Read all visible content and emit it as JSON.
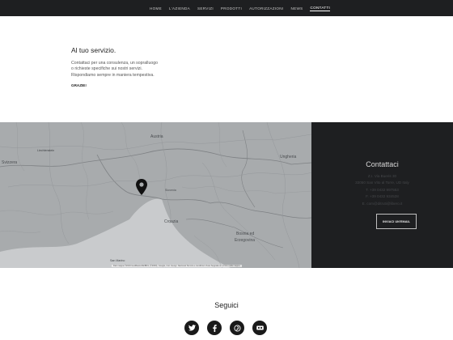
{
  "nav": {
    "items": [
      {
        "label": "HOME"
      },
      {
        "label": "L'AZIENDA"
      },
      {
        "label": "SERVIZI"
      },
      {
        "label": "PRODOTTI"
      },
      {
        "label": "AUTORIZZAZIONI"
      },
      {
        "label": "NEWS"
      },
      {
        "label": "CONTATTI",
        "active": true
      }
    ]
  },
  "intro": {
    "title": "Al tuo servizio.",
    "lines": [
      "Contattaci per una consulenza, un sopralluogo",
      "o richieste specifiche sui nostri servizi.",
      "Rispondiamo sempre in maniera tempestiva."
    ],
    "thanks": "GRAZIE!"
  },
  "map": {
    "labels": {
      "austria": "Austria",
      "ungheria": "Ungheria",
      "svizzera": "Svizzera",
      "slovenia": "Slovenia",
      "croazia": "Croazia",
      "bosnia_1": "Bosnia ed",
      "bosnia_2": "Erzegovina",
      "san_marino": "San Marino",
      "city_1": "Liechtenstein"
    },
    "attribution": "Dati mappa ©2019 GeoBasis-DE/BKG (©2009), Google, Inst. Geogr. Nacional   Termini e condizioni d'uso   Segnala un errore nella mappa"
  },
  "contact": {
    "title": "Contattaci",
    "lines": [
      "Z.I. Via Bueris 30",
      "33050 San Vito al Torre, UD Italy",
      "T. +39 0432 997553",
      "F. +39 0432 934528",
      "E. com@ditruti@libero.it"
    ],
    "button": "INVIACI UN'EMAIL"
  },
  "follow": {
    "title": "Seguici",
    "socials": [
      "twitter-icon",
      "facebook-icon",
      "pinterest-icon",
      "flickr-icon"
    ]
  },
  "colors": {
    "nav_bg": "#1e1f21",
    "map_bg": "#a8abad",
    "panel_bg": "#1e1f21",
    "social_bg": "#1a1a1a"
  }
}
